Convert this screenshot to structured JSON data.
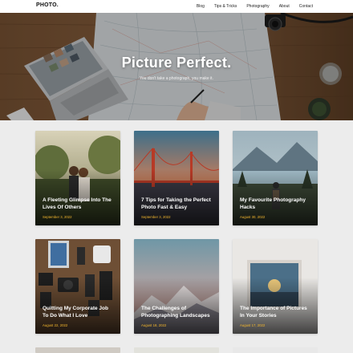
{
  "site": {
    "logo": "PHOTO."
  },
  "nav": {
    "items": [
      {
        "label": "Blog"
      },
      {
        "label": "Tips & Tricks"
      },
      {
        "label": "Photography"
      },
      {
        "label": "About"
      },
      {
        "label": "Contact"
      }
    ]
  },
  "hero": {
    "title": "Picture Perfect.",
    "subtitle": "You don't take a photograph, you make it."
  },
  "posts": [
    {
      "title": "A Fleeting Glimpse Into The Lives Of Others",
      "date": "September 3, 2022"
    },
    {
      "title": "7 Tips for Taking the Perfect Photo Fast & Easy",
      "date": "September 3, 2022"
    },
    {
      "title": "My Favourite Photography Hacks",
      "date": "August 30, 2022"
    },
    {
      "title": "Quitting My Corporate Job To Do What I Love",
      "date": "August 22, 2022"
    },
    {
      "title": "The Challenges of Photographing Landscapes",
      "date": "August 18, 2022"
    },
    {
      "title": "The Importance of Pictures In Your Stories",
      "date": "August 17, 2022"
    }
  ],
  "colors": {
    "accent": "#f5b82e",
    "nav_bg": "#ffffff",
    "page_bg": "#ececec"
  }
}
